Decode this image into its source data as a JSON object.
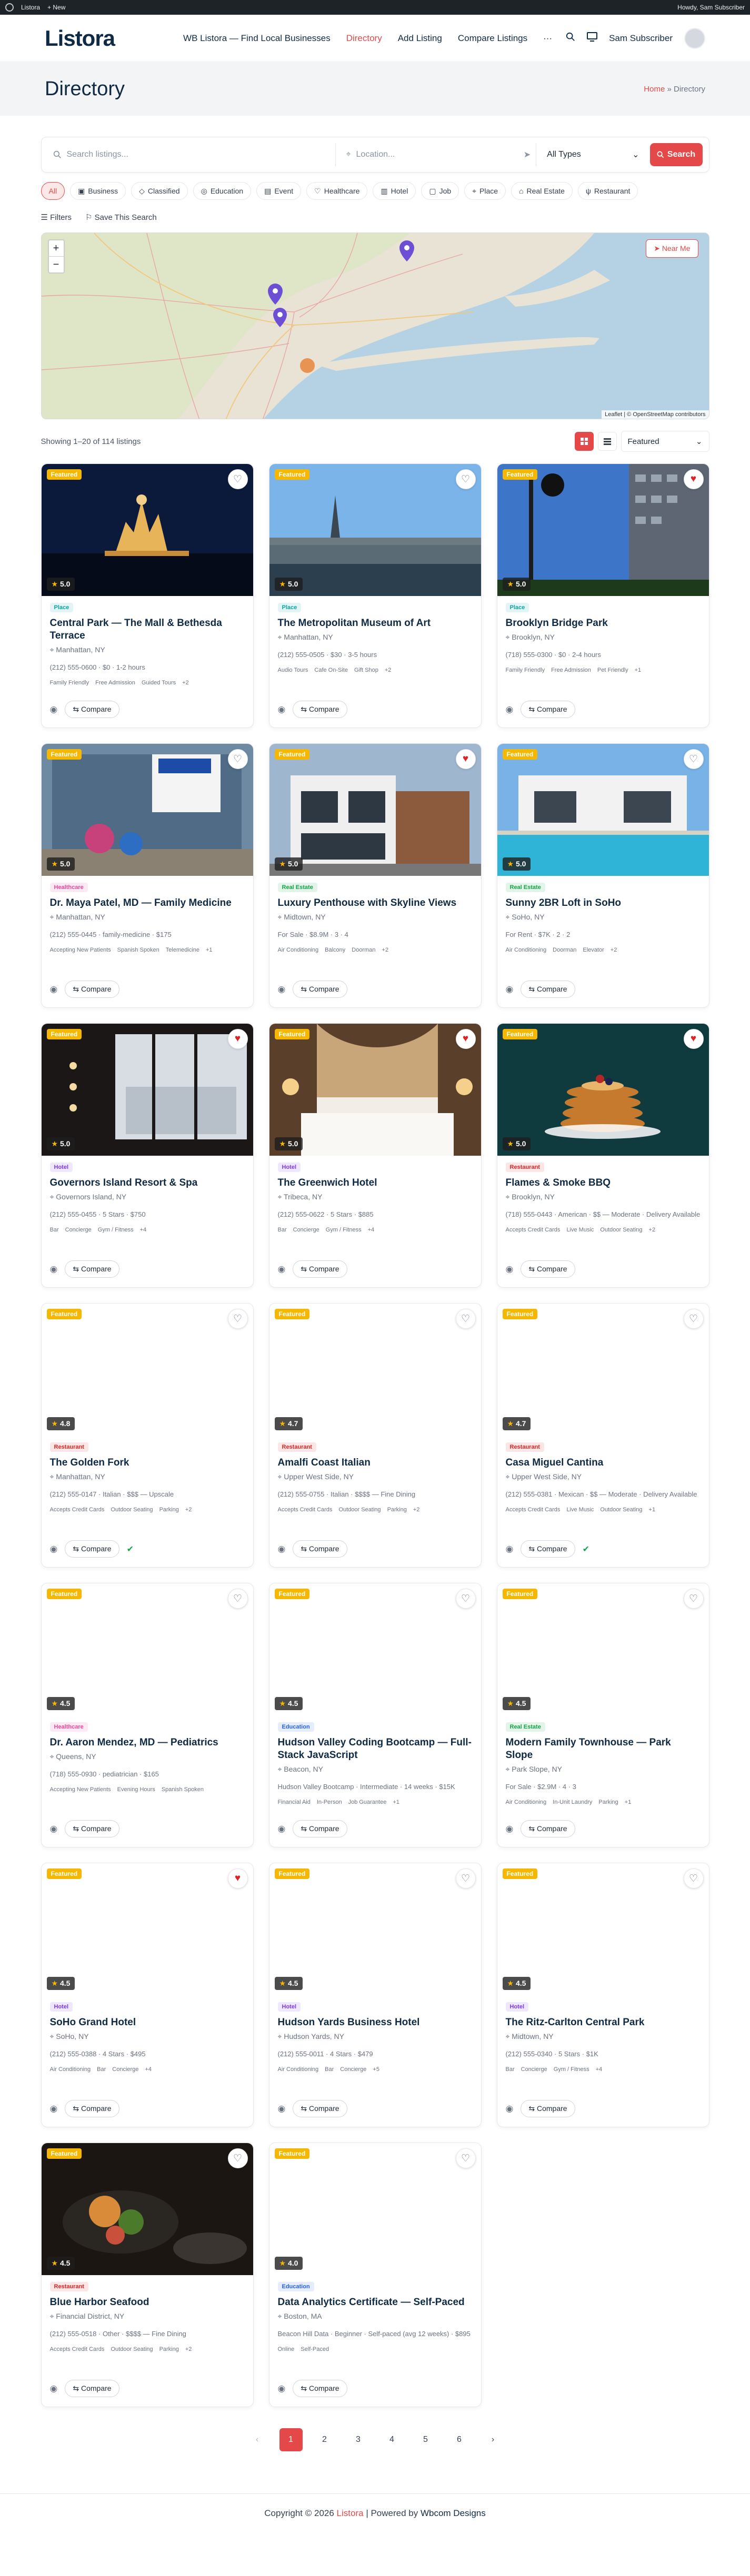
{
  "wpbar": {
    "site": "Listora",
    "new": "+ New",
    "howdy": "Howdy, Sam Subscriber"
  },
  "header": {
    "logo": "Listora",
    "nav": [
      "WB Listora — Find Local Businesses",
      "Directory",
      "Add Listing",
      "Compare Listings"
    ],
    "more": "···",
    "user": "Sam Subscriber"
  },
  "title": {
    "heading": "Directory",
    "crumb_home": "Home",
    "crumb_sep": "»",
    "crumb_current": "Directory"
  },
  "search": {
    "keyword_placeholder": "Search listings...",
    "location_placeholder": "Location...",
    "type": "All Types",
    "button": "Search"
  },
  "chips": [
    "All",
    "Business",
    "Classified",
    "Education",
    "Event",
    "Healthcare",
    "Hotel",
    "Job",
    "Place",
    "Real Estate",
    "Restaurant"
  ],
  "filters": {
    "filters_label": "Filters",
    "save_label": "Save This Search"
  },
  "map": {
    "zoom_in": "+",
    "zoom_out": "−",
    "near_me": "Near Me",
    "attribution": "Leaflet | © OpenStreetMap contributors"
  },
  "results": {
    "count_text": "Showing 1–20 of 114 listings",
    "sort": "Featured"
  },
  "card_labels": {
    "compare": "Compare"
  },
  "listings": [
    {
      "featured": "Featured",
      "fav": false,
      "rating": "5.0",
      "cat": "Place",
      "cat_color": "#0ea5a0",
      "title": "Central Park — The Mall & Bethesda Terrace",
      "loc": "Manhattan, NY",
      "meta": "(212) 555-0600 · $0 · 1-2 hours",
      "feats": [
        "Family Friendly",
        "Free Admission",
        "Guided Tours",
        "+2"
      ],
      "img": "night"
    },
    {
      "featured": "Featured",
      "fav": false,
      "rating": "5.0",
      "cat": "Place",
      "cat_color": "#0ea5a0",
      "title": "The Metropolitan Museum of Art",
      "loc": "Manhattan, NY",
      "meta": "(212) 555-0505 · $30 · 3-5 hours",
      "feats": [
        "Audio Tours",
        "Cafe On-Site",
        "Gift Shop",
        "+2"
      ],
      "img": "river"
    },
    {
      "featured": "Featured",
      "fav": true,
      "rating": "5.0",
      "cat": "Place",
      "cat_color": "#0ea5a0",
      "title": "Brooklyn Bridge Park",
      "loc": "Brooklyn, NY",
      "meta": "(718) 555-0300 · $0 · 2-4 hours",
      "feats": [
        "Family Friendly",
        "Free Admission",
        "Pet Friendly",
        "+1"
      ],
      "img": "sky"
    },
    {
      "featured": "Featured",
      "fav": false,
      "rating": "5.0",
      "cat": "Healthcare",
      "cat_color": "#ec4899",
      "title": "Dr. Maya Patel, MD — Family Medicine",
      "loc": "Manhattan, NY",
      "meta": "(212) 555-0445 · family-medicine · $175",
      "feats": [
        "Accepting New Patients",
        "Spanish Spoken",
        "Telemedicine",
        "+1"
      ],
      "img": "street"
    },
    {
      "featured": "Featured",
      "fav": true,
      "rating": "5.0",
      "cat": "Real Estate",
      "cat_color": "#16a34a",
      "title": "Luxury Penthouse with Skyline Views",
      "loc": "Midtown, NY",
      "meta": "For Sale · $8.9M · 3 · 4",
      "feats": [
        "Air Conditioning",
        "Balcony",
        "Doorman",
        "+2"
      ],
      "img": "house"
    },
    {
      "featured": "Featured",
      "fav": false,
      "rating": "5.0",
      "cat": "Real Estate",
      "cat_color": "#16a34a",
      "title": "Sunny 2BR Loft in SoHo",
      "loc": "SoHo, NY",
      "meta": "For Rent · $7K · 2 · 2",
      "feats": [
        "Air Conditioning",
        "Doorman",
        "Elevator",
        "+2"
      ],
      "img": "pool"
    },
    {
      "featured": "Featured",
      "fav": true,
      "rating": "5.0",
      "cat": "Hotel",
      "cat_color": "#7c3aed",
      "title": "Governors Island Resort & Spa",
      "loc": "Governors Island, NY",
      "meta": "(212) 555-0455 · 5 Stars · $750",
      "feats": [
        "Bar",
        "Concierge",
        "Gym / Fitness",
        "+4"
      ],
      "img": "room"
    },
    {
      "featured": "Featured",
      "fav": true,
      "rating": "5.0",
      "cat": "Hotel",
      "cat_color": "#7c3aed",
      "title": "The Greenwich Hotel",
      "loc": "Tribeca, NY",
      "meta": "(212) 555-0622 · 5 Stars · $885",
      "feats": [
        "Bar",
        "Concierge",
        "Gym / Fitness",
        "+4"
      ],
      "img": "bed"
    },
    {
      "featured": "Featured",
      "fav": true,
      "rating": "5.0",
      "cat": "Restaurant",
      "cat_color": "#dc2626",
      "title": "Flames & Smoke BBQ",
      "loc": "Brooklyn, NY",
      "meta": "(718) 555-0443 · American · $$ — Moderate · Delivery Available",
      "feats": [
        "Accepts Credit Cards",
        "Live Music",
        "Outdoor Seating",
        "+2"
      ],
      "img": "pancake"
    },
    {
      "featured": "Featured",
      "fav": false,
      "rating": "4.8",
      "cat": "Restaurant",
      "cat_color": "#dc2626",
      "title": "The Golden Fork",
      "loc": "Manhattan, NY",
      "meta": "(212) 555-0147 · Italian · $$$ — Upscale",
      "feats": [
        "Accepts Credit Cards",
        "Outdoor Seating",
        "Parking",
        "+2"
      ],
      "img": "blank",
      "check": true
    },
    {
      "featured": "Featured",
      "fav": false,
      "rating": "4.7",
      "cat": "Restaurant",
      "cat_color": "#dc2626",
      "title": "Amalfi Coast Italian",
      "loc": "Upper West Side, NY",
      "meta": "(212) 555-0755 · Italian · $$$$ — Fine Dining",
      "feats": [
        "Accepts Credit Cards",
        "Outdoor Seating",
        "Parking",
        "+2"
      ],
      "img": "blank"
    },
    {
      "featured": "Featured",
      "fav": false,
      "rating": "4.7",
      "cat": "Restaurant",
      "cat_color": "#dc2626",
      "title": "Casa Miguel Cantina",
      "loc": "Upper West Side, NY",
      "meta": "(212) 555-0381 · Mexican · $$ — Moderate · Delivery Available",
      "feats": [
        "Accepts Credit Cards",
        "Live Music",
        "Outdoor Seating",
        "+1"
      ],
      "img": "blank",
      "check": true
    },
    {
      "featured": "Featured",
      "fav": false,
      "rating": "4.5",
      "cat": "Healthcare",
      "cat_color": "#ec4899",
      "title": "Dr. Aaron Mendez, MD — Pediatrics",
      "loc": "Queens, NY",
      "meta": "(718) 555-0930 · pediatrician · $165",
      "feats": [
        "Accepting New Patients",
        "Evening Hours",
        "Spanish Spoken"
      ],
      "img": "blank"
    },
    {
      "featured": "Featured",
      "fav": false,
      "rating": "4.5",
      "cat": "Education",
      "cat_color": "#2563eb",
      "title": "Hudson Valley Coding Bootcamp — Full-Stack JavaScript",
      "loc": "Beacon, NY",
      "meta": "Hudson Valley Bootcamp · Intermediate · 14 weeks · $15K",
      "feats": [
        "Financial Aid",
        "In-Person",
        "Job Guarantee",
        "+1"
      ],
      "img": "blank"
    },
    {
      "featured": "Featured",
      "fav": false,
      "rating": "4.5",
      "cat": "Real Estate",
      "cat_color": "#16a34a",
      "title": "Modern Family Townhouse — Park Slope",
      "loc": "Park Slope, NY",
      "meta": "For Sale · $2.9M · 4 · 3",
      "feats": [
        "Air Conditioning",
        "In-Unit Laundry",
        "Parking",
        "+1"
      ],
      "img": "blank"
    },
    {
      "featured": "Featured",
      "fav": true,
      "rating": "4.5",
      "cat": "Hotel",
      "cat_color": "#7c3aed",
      "title": "SoHo Grand Hotel",
      "loc": "SoHo, NY",
      "meta": "(212) 555-0388 · 4 Stars · $495",
      "feats": [
        "Air Conditioning",
        "Bar",
        "Concierge",
        "+4"
      ],
      "img": "blank"
    },
    {
      "featured": "Featured",
      "fav": false,
      "rating": "4.5",
      "cat": "Hotel",
      "cat_color": "#7c3aed",
      "title": "Hudson Yards Business Hotel",
      "loc": "Hudson Yards, NY",
      "meta": "(212) 555-0011 · 4 Stars · $479",
      "feats": [
        "Air Conditioning",
        "Bar",
        "Concierge",
        "+5"
      ],
      "img": "blank"
    },
    {
      "featured": "Featured",
      "fav": false,
      "rating": "4.5",
      "cat": "Hotel",
      "cat_color": "#7c3aed",
      "title": "The Ritz-Carlton Central Park",
      "loc": "Midtown, NY",
      "meta": "(212) 555-0340 · 5 Stars · $1K",
      "feats": [
        "Bar",
        "Concierge",
        "Gym / Fitness",
        "+4"
      ],
      "img": "blank"
    },
    {
      "featured": "Featured",
      "fav": false,
      "rating": "4.5",
      "cat": "Restaurant",
      "cat_color": "#dc2626",
      "title": "Blue Harbor Seafood",
      "loc": "Financial District, NY",
      "meta": "(212) 555-0518 · Other · $$$$ — Fine Dining",
      "feats": [
        "Accepts Credit Cards",
        "Outdoor Seating",
        "Parking",
        "+2"
      ],
      "img": "food"
    },
    {
      "featured": "Featured",
      "fav": false,
      "rating": "4.0",
      "cat": "Education",
      "cat_color": "#2563eb",
      "title": "Data Analytics Certificate — Self-Paced",
      "loc": "Boston, MA",
      "meta": "Beacon Hill Data · Beginner · Self-paced (avg 12 weeks) · $895",
      "feats": [
        "Online",
        "Self-Paced"
      ],
      "img": "blank"
    }
  ],
  "pagination": {
    "prev": "‹",
    "pages": [
      "1",
      "2",
      "3",
      "4",
      "5",
      "6"
    ],
    "next": "›"
  },
  "footer": {
    "copy": "Copyright © 2026",
    "brand": "Listora",
    "powered": "| Powered by",
    "credit": "Wbcom Designs"
  }
}
